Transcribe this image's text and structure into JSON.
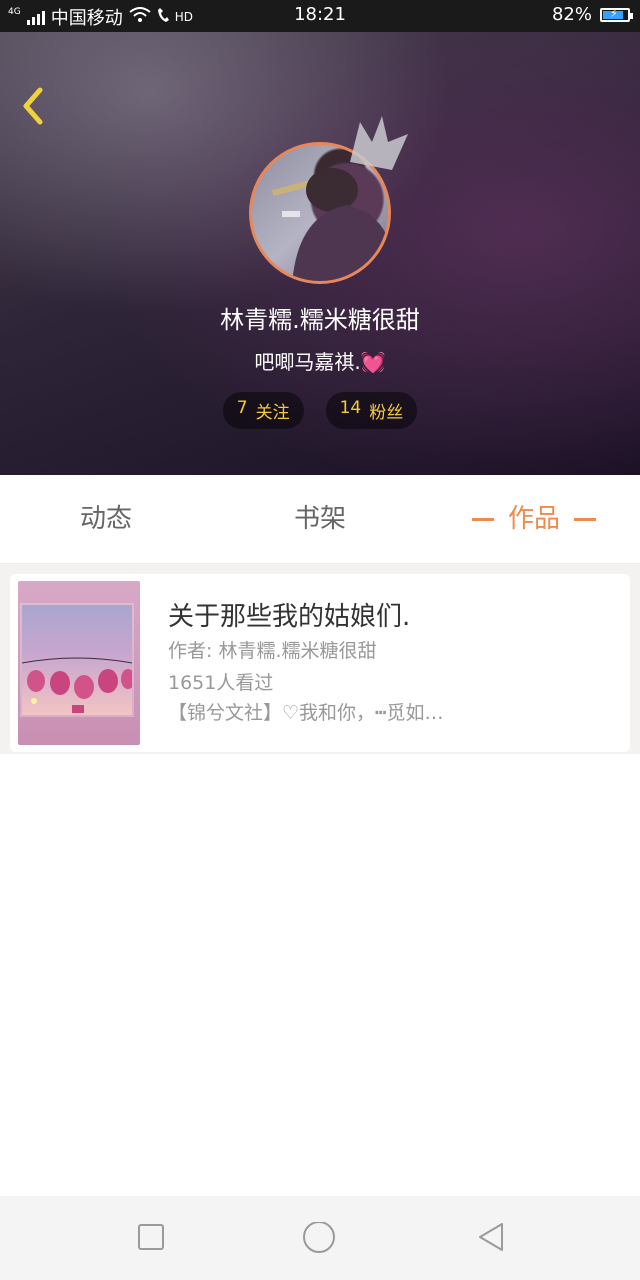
{
  "status_bar": {
    "network": "4G",
    "carrier": "中国移动",
    "hd": "HD",
    "time": "18:21",
    "battery": "82%",
    "battery_level": 0.82
  },
  "profile": {
    "name": "林青糯.糯米糖很甜",
    "signature": "吧唧马嘉祺.",
    "following_count": "7",
    "following_label": "关注",
    "followers_count": "14",
    "followers_label": "粉丝"
  },
  "tabs": [
    {
      "label": "动态",
      "active": false
    },
    {
      "label": "书架",
      "active": false
    },
    {
      "label": "作品",
      "active": true
    }
  ],
  "works": [
    {
      "title": "关于那些我的姑娘们.",
      "author": "作者: 林青糯.糯米糖很甜",
      "views": "1651人看过",
      "tags": "【锦兮文社】♡我和你，┅觅如…"
    }
  ],
  "colors": {
    "accent": "#f08a4b",
    "stat_text": "#f5cb3a",
    "back_icon": "#f2d23a"
  }
}
